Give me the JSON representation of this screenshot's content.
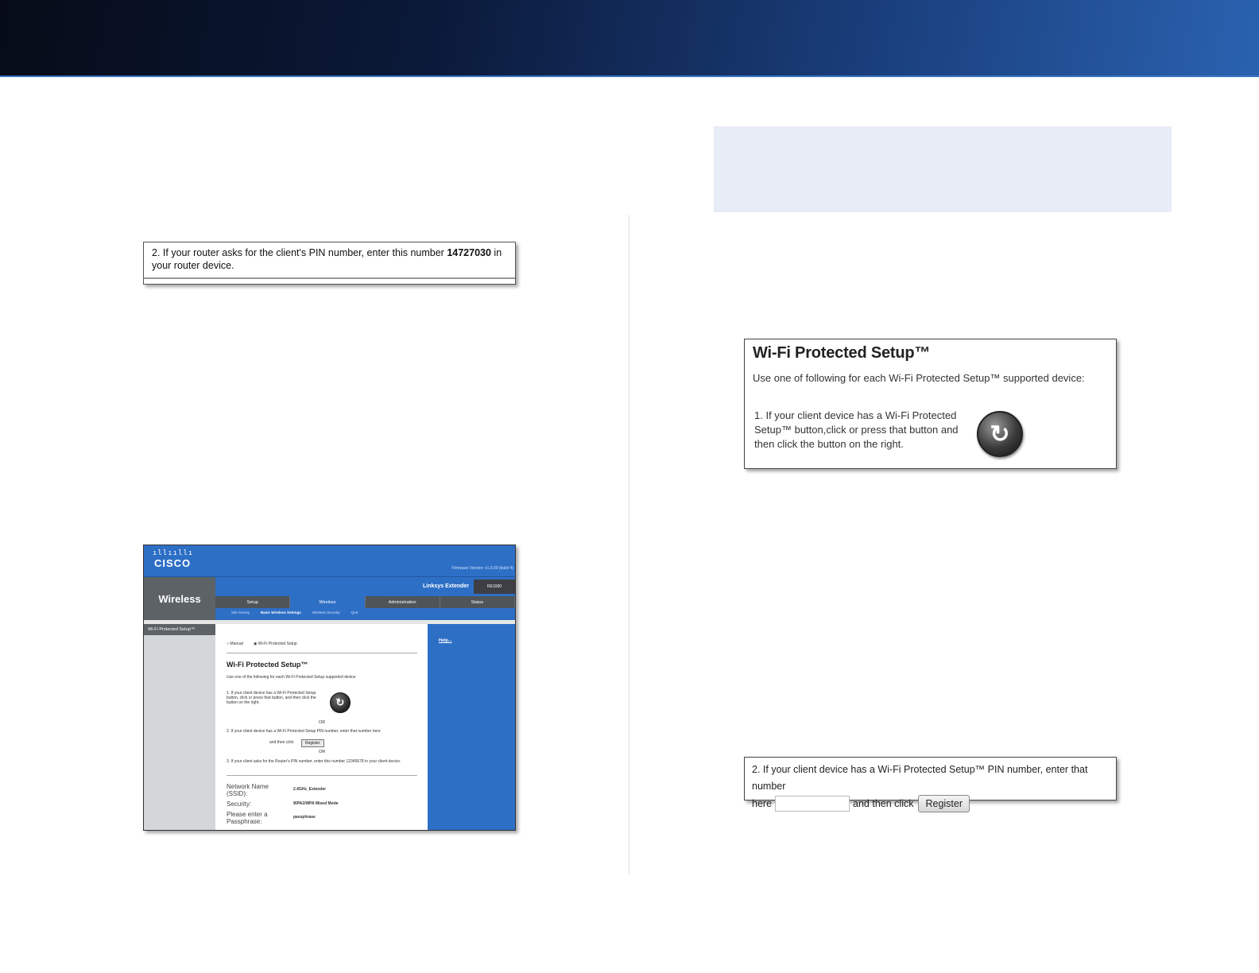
{
  "pin_note": {
    "text_before": "2. If your router asks for the client's PIN number, enter this number ",
    "pin": "14727030",
    "text_after": " in your router device."
  },
  "router_ui": {
    "logo_bars": "ıllııllı",
    "logo": "CISCO",
    "firmware": "Firmware Version: v1.0.00 (build 4)",
    "section_title": "Wireless",
    "product_name": "Linksys Extender",
    "model": "RE1000",
    "tabs": [
      "Setup",
      "Wireless",
      "Administration",
      "Status"
    ],
    "active_tab": "Wireless",
    "subtabs": [
      "Site Survey",
      "Basic Wireless Settings",
      "Wireless Security",
      "QoS"
    ],
    "left_label": "Wi-Fi Protected Setup™",
    "radio_manual": "Manual",
    "radio_wps": "Wi-Fi Protected Setup",
    "wps_title": "Wi-Fi Protected Setup™",
    "wps_intro": "Use one of the following for each Wi-Fi Protected Setup supported device",
    "step1": "1. If your client device has a Wi-Fi Protected Setup button, click or press that button, and then click the button on the right.",
    "or1": "OR",
    "step2": "2. If your client device has a Wi-Fi Protected Setup PIN number, enter that number here",
    "step2b": "and then click",
    "register": "Register",
    "or2": "OR",
    "step3": "3. If your client asks for the Router's PIN number, enter this number 12345678 in your client device.",
    "net_name_label": "Network Name (SSID):",
    "net_name_value": "2.4GHz_Extender",
    "security_label": "Security:",
    "security_value": "WPA2/WPA Mixed Mode",
    "pass_label": "Please enter a Passphrase:",
    "pass_value": "passphrase",
    "help_link": "Help..."
  },
  "wps_panel": {
    "title": "Wi-Fi Protected Setup™",
    "subtitle": "Use one of following for each Wi-Fi Protected Setup™ supported device:",
    "step1": "1. If your client device has a Wi-Fi Protected Setup™ button,click or press that button and then click the button on the right.",
    "icon_glyph": "↻"
  },
  "pin_register": {
    "line1": "2. If your client device has a Wi-Fi Protected Setup™ PIN number, enter that number",
    "here": "here",
    "then_click": "and then click",
    "button": "Register"
  },
  "icons": [
    "wps-icon"
  ]
}
